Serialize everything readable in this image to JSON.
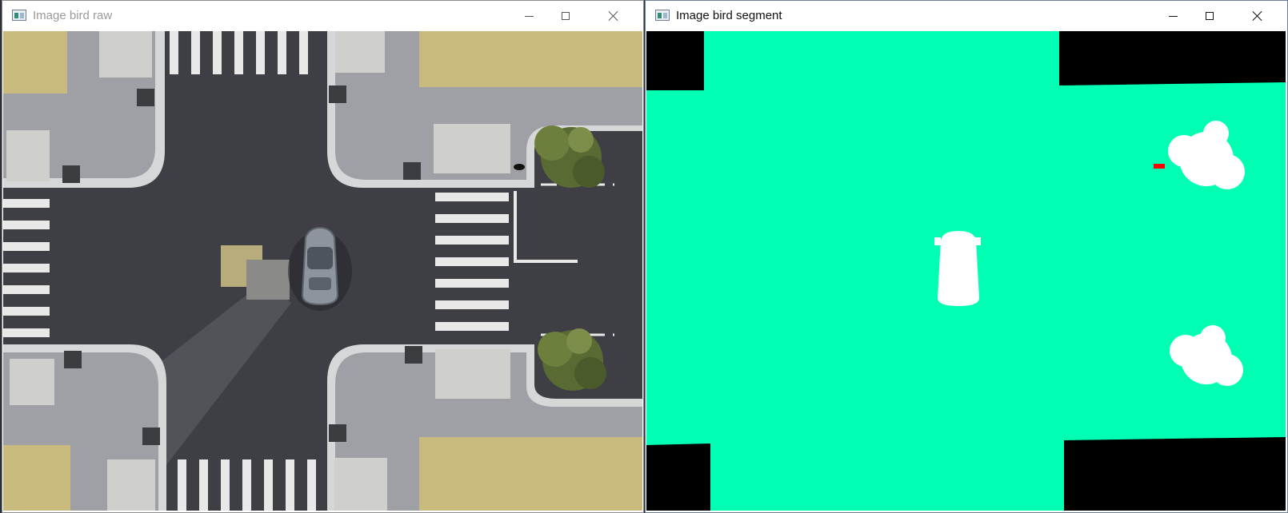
{
  "windows": [
    {
      "title": "Image bird raw",
      "view": "bird's-eye camera image",
      "icons": [
        "app-icon",
        "minimize-icon",
        "maximize-icon",
        "close-icon"
      ]
    },
    {
      "title": "Image bird segment",
      "view": "semantic segmentation image",
      "icons": [
        "app-icon",
        "minimize-icon",
        "maximize-icon",
        "close-icon"
      ]
    }
  ],
  "colors": {
    "road": "#3d3f44",
    "sidewalk": "#9ea0a5",
    "curb": "#d6d7d9",
    "grass": "#c9bb7d",
    "tree": "#596a33",
    "segment_road": "#00ffb3",
    "segment_vehicle": "#ffffff",
    "segment_vegetation": "#ffffff",
    "segment_pedestrian": "#ff0000",
    "segment_unlabeled": "#000000"
  }
}
